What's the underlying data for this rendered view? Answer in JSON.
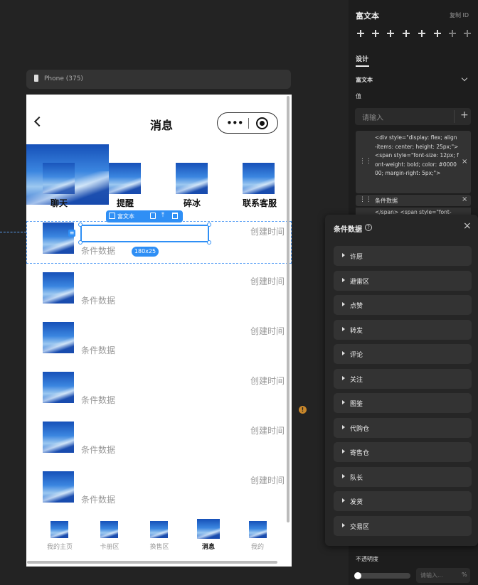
{
  "device": {
    "label": "Phone (375)"
  },
  "phone": {
    "title": "消息",
    "tabs": [
      "聊天",
      "提醒",
      "碎冰",
      "联系客服"
    ],
    "rows": [
      {
        "time": "创建时间",
        "text": "条件数据"
      },
      {
        "time": "创建时间",
        "text": "条件数据"
      },
      {
        "time": "创建时间",
        "text": "条件数据"
      },
      {
        "time": "创建时间",
        "text": "条件数据"
      },
      {
        "time": "创建时间",
        "text": "条件数据"
      },
      {
        "time": "创建时间",
        "text": "条件数据"
      }
    ],
    "selection": {
      "label": "富文本",
      "size": "180x25"
    },
    "nav": [
      "我的主页",
      "卡册区",
      "换售区",
      "消息",
      "我的"
    ],
    "nav_active": "消息"
  },
  "right_panel": {
    "title": "富文本",
    "copy_id": "复制 ID",
    "tab_design": "设计",
    "section": "富文本",
    "value_label": "值",
    "input_placeholder": "请输入",
    "code1": "<div style=\"display: flex; align-items: center; height: 25px;\"> <span style=\"font-size: 12px; font-weight: bold; color: #000000; margin-right: 5px;\">",
    "chip": "条件数据",
    "code2": "</span> <span style=\"font-",
    "opacity_label": "不透明度",
    "opacity_placeholder": "请输入...",
    "opacity_unit": "%",
    "opacity_value": 0
  },
  "condition_panel": {
    "title": "条件数据",
    "items": [
      "许愿",
      "避雷区",
      "点赞",
      "转发",
      "评论",
      "关注",
      "图鉴",
      "代购仓",
      "寄售仓",
      "队长",
      "发货",
      "交易区"
    ]
  }
}
